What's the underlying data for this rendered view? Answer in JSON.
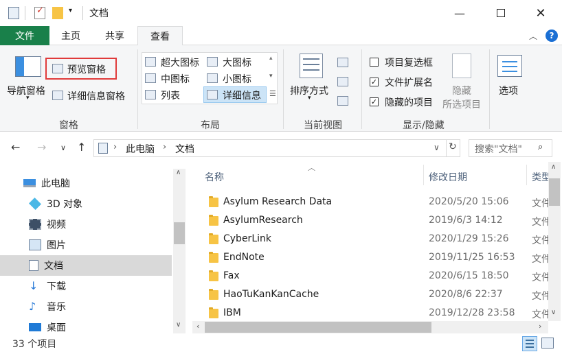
{
  "window": {
    "title": "文档"
  },
  "tabs": {
    "file": "文件",
    "home": "主页",
    "share": "共享",
    "view": "查看"
  },
  "ribbon": {
    "panes": {
      "nav_pane": "导航窗格",
      "preview_pane": "预览窗格",
      "details_pane": "详细信息窗格",
      "group_label": "窗格"
    },
    "layout": {
      "extra_large": "超大图标",
      "large": "大图标",
      "medium": "中图标",
      "small": "小图标",
      "list": "列表",
      "details": "详细信息",
      "group_label": "布局"
    },
    "current_view": {
      "sort_by": "排序方式",
      "group_label": "当前视图"
    },
    "show_hide": {
      "item_checkboxes": "项目复选框",
      "file_extensions": "文件扩展名",
      "hidden_items": "隐藏的项目",
      "hide_selected_1": "隐藏",
      "hide_selected_2": "所选项目",
      "options": "选项",
      "group_label": "显示/隐藏",
      "item_checkboxes_checked": false,
      "file_extensions_checked": true,
      "hidden_items_checked": true
    }
  },
  "address": {
    "crumbs": [
      "此电脑",
      "文档"
    ],
    "search_placeholder": "搜索\"文档\""
  },
  "nav": {
    "items": [
      {
        "label": "此电脑",
        "icon": "pc-icon"
      },
      {
        "label": "3D 对象",
        "icon": "3d-objects-icon"
      },
      {
        "label": "视频",
        "icon": "video-icon"
      },
      {
        "label": "图片",
        "icon": "pictures-icon"
      },
      {
        "label": "文档",
        "icon": "documents-icon"
      },
      {
        "label": "下载",
        "icon": "download-icon"
      },
      {
        "label": "音乐",
        "icon": "music-icon"
      },
      {
        "label": "桌面",
        "icon": "desktop-icon"
      }
    ]
  },
  "files": {
    "columns": {
      "name": "名称",
      "date": "修改日期",
      "type": "类型"
    },
    "rows": [
      {
        "name": "Asylum Research Data",
        "date": "2020/5/20 15:06",
        "type": "文件"
      },
      {
        "name": "AsylumResearch",
        "date": "2019/6/3 14:12",
        "type": "文件"
      },
      {
        "name": "CyberLink",
        "date": "2020/1/29 15:26",
        "type": "文件"
      },
      {
        "name": "EndNote",
        "date": "2019/11/25 16:53",
        "type": "文件"
      },
      {
        "name": "Fax",
        "date": "2020/6/15 18:50",
        "type": "文件"
      },
      {
        "name": "HaoTuKanKanCache",
        "date": "2020/8/6 22:37",
        "type": "文件"
      },
      {
        "name": "IBM",
        "date": "2019/12/28 23:58",
        "type": "文件"
      }
    ]
  },
  "status": {
    "count": "33 个项目"
  },
  "colors": {
    "accent": "#19804a",
    "highlight": "#e03a3a",
    "selection": "#d9d9d9"
  }
}
